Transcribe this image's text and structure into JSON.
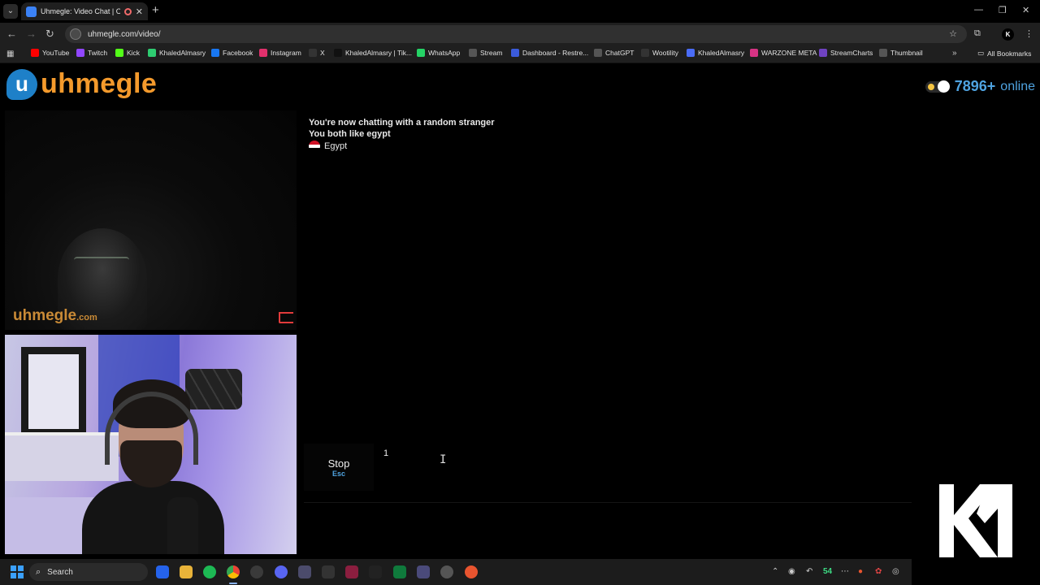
{
  "browser": {
    "tab_title": "Uhmegle: Video Chat | Ome",
    "url": "uhmegle.com/video/",
    "bookmarks": [
      {
        "label": "YouTube",
        "color": "#ff0000"
      },
      {
        "label": "Twitch",
        "color": "#9146ff"
      },
      {
        "label": "Kick",
        "color": "#53fc18"
      },
      {
        "label": "KhaledAlmasry",
        "color": "#2ecc71"
      },
      {
        "label": "Facebook",
        "color": "#1877f2"
      },
      {
        "label": "Instagram",
        "color": "#e1306c"
      },
      {
        "label": "X",
        "color": "#333333"
      },
      {
        "label": "KhaledAlmasry | Tik...",
        "color": "#111111"
      },
      {
        "label": "WhatsApp",
        "color": "#25d366"
      },
      {
        "label": "Stream",
        "color": "#555555"
      },
      {
        "label": "Dashboard - Restre...",
        "color": "#3b5bdb"
      },
      {
        "label": "ChatGPT",
        "color": "#555555"
      },
      {
        "label": "Wootility",
        "color": "#333333"
      },
      {
        "label": "KhaledAlmasry",
        "color": "#4a6cf7"
      },
      {
        "label": "WARZONE META",
        "color": "#d63384"
      },
      {
        "label": "StreamCharts",
        "color": "#6f42c1"
      },
      {
        "label": "Thumbnail",
        "color": "#555555"
      }
    ],
    "all_bookmarks": "All Bookmarks"
  },
  "site": {
    "logo_text": "uhmegle",
    "online_count": "7896+",
    "online_label": "online",
    "watermark_main": "uhmegle",
    "watermark_suffix": ".com"
  },
  "chat": {
    "status": "You're now chatting with a random stranger",
    "interest": "You both like egypt",
    "country": "Egypt",
    "stop_label": "Stop",
    "stop_key": "Esc",
    "input_value": "1"
  },
  "taskbar": {
    "search_label": "Search",
    "tray_badge": "54"
  },
  "colors": {
    "brand_orange": "#f49a2c",
    "brand_blue": "#4fa3e0"
  }
}
